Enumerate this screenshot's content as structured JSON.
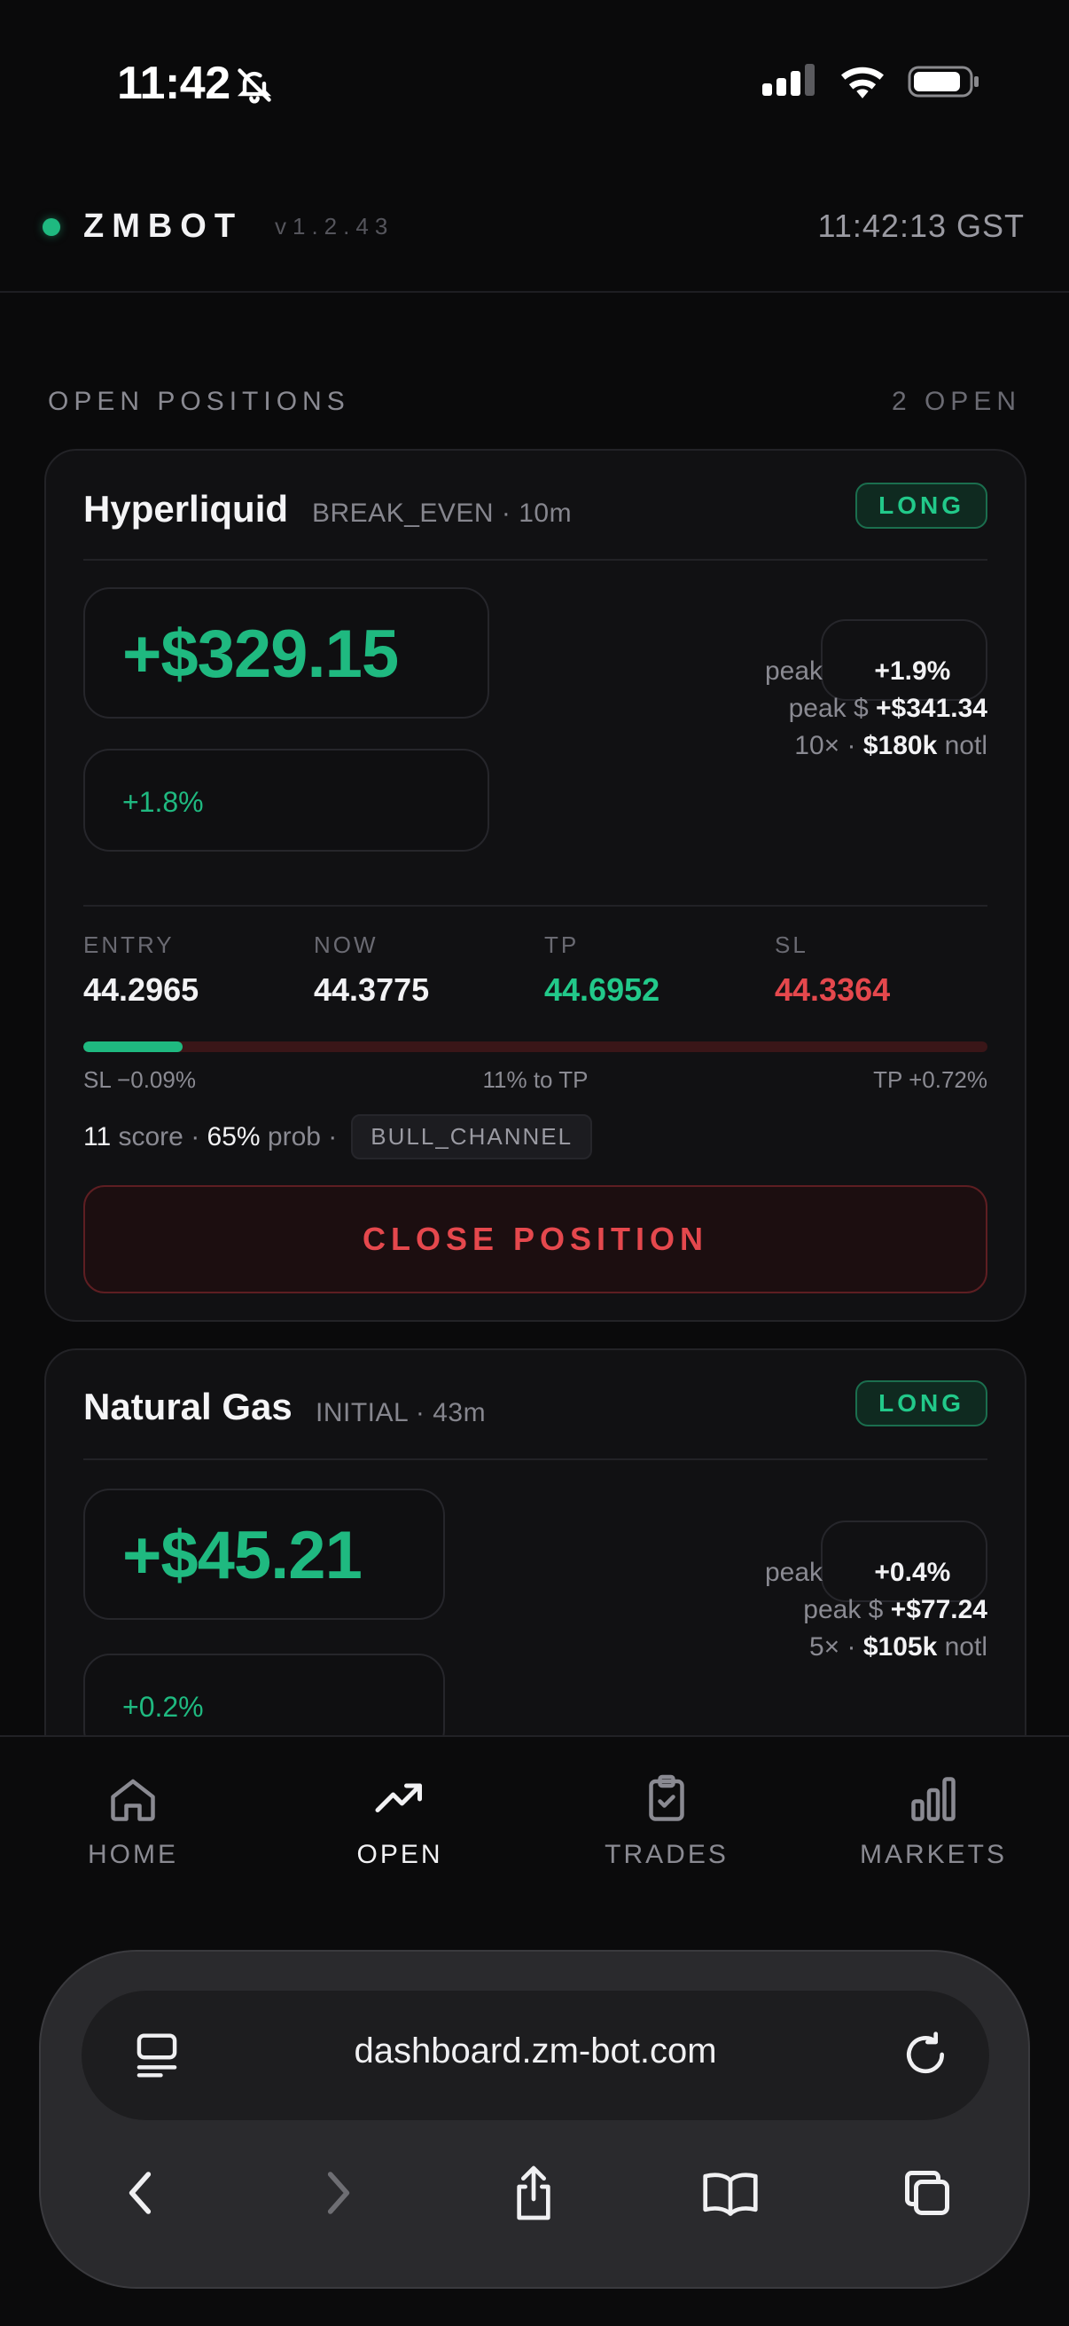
{
  "status_bar": {
    "time": "11:42"
  },
  "header": {
    "brand": "ZMBOT",
    "version": "v1.2.43",
    "clock": "11:42:13 GST"
  },
  "section": {
    "title": "OPEN POSITIONS",
    "count": "2 OPEN"
  },
  "positions": [
    {
      "asset": "Hyperliquid",
      "meta": "BREAK_EVEN · 10m",
      "side": "LONG",
      "pnl": "+$329.15",
      "pnl_pct": "+1.8%",
      "peak_label": "peak",
      "peak_pct": "+1.9%",
      "peak_usd_label": "peak $",
      "peak_usd": "+$341.34",
      "leverage": "10×",
      "sep": "·",
      "notional": "$180k",
      "notional_label": "notl",
      "entry_label": "ENTRY",
      "entry": "44.2965",
      "now_label": "NOW",
      "now": "44.3775",
      "tp_label": "TP",
      "tp": "44.6952",
      "sl_label": "SL",
      "sl": "44.3364",
      "progress_fraction": 0.11,
      "sl_dist": "SL −0.09%",
      "to_tp": "11% to TP",
      "tp_dist": "TP +0.72%",
      "score": "11",
      "score_label": "score",
      "prob": "65%",
      "prob_label": "prob",
      "regime": "BULL_CHANNEL",
      "close_label": "CLOSE POSITION"
    },
    {
      "asset": "Natural Gas",
      "meta": "INITIAL · 43m",
      "side": "LONG",
      "pnl": "+$45.21",
      "pnl_pct": "+0.2%",
      "peak_label": "peak",
      "peak_pct": "+0.4%",
      "peak_usd_label": "peak $",
      "peak_usd": "+$77.24",
      "leverage": "5×",
      "sep": "·",
      "notional": "$105k",
      "notional_label": "notl"
    }
  ],
  "tabs": [
    {
      "label": "HOME",
      "icon": "home-icon"
    },
    {
      "label": "OPEN",
      "icon": "trending-up-icon",
      "active": true
    },
    {
      "label": "TRADES",
      "icon": "clipboard-check-icon"
    },
    {
      "label": "MARKETS",
      "icon": "bar-chart-icon"
    }
  ],
  "browser": {
    "url": "dashboard.zm-bot.com"
  },
  "colors": {
    "accent_green": "#1fb980",
    "danger_red": "#e5484d",
    "background": "#0a0a0b"
  }
}
